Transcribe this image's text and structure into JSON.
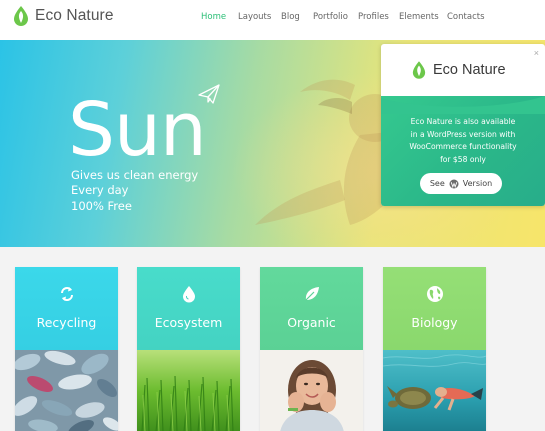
{
  "header": {
    "logo_text": "Eco Nature",
    "nav": [
      {
        "label": "Home",
        "active": true
      },
      {
        "label": "Layouts",
        "active": false
      },
      {
        "label": "Blog",
        "active": false
      },
      {
        "label": "Portfolio",
        "active": false
      },
      {
        "label": "Profiles",
        "active": false
      },
      {
        "label": "Elements",
        "active": false
      },
      {
        "label": "Contacts",
        "active": false
      }
    ]
  },
  "hero": {
    "title": "Sun",
    "lines": [
      "Gives us clean energy",
      "Every day",
      "100% Free"
    ]
  },
  "popup": {
    "close": "×",
    "brand": "Eco Nature",
    "body_lines": [
      "Eco Nature is also available",
      "in a WordPress version with",
      "WooCommerce functionality",
      "for $58 only"
    ],
    "button_prefix": "See",
    "button_suffix": "Version"
  },
  "cards": [
    {
      "title": "Recycling",
      "icon": "recycle-icon",
      "color_top": "#3ad6e6",
      "image": "recycling-bottles-photo"
    },
    {
      "title": "Ecosystem",
      "icon": "water-drop-icon",
      "color_top": "#46d8c9",
      "image": "grass-photo"
    },
    {
      "title": "Organic",
      "icon": "leaf-icon",
      "color_top": "#5fd69b",
      "image": "smiling-woman-photo"
    },
    {
      "title": "Biology",
      "icon": "globe-icon",
      "color_top": "#8edc73",
      "image": "diver-turtle-photo"
    }
  ],
  "colors": {
    "accent": "#2cbf77",
    "popup_green": "#2fbe8c"
  }
}
